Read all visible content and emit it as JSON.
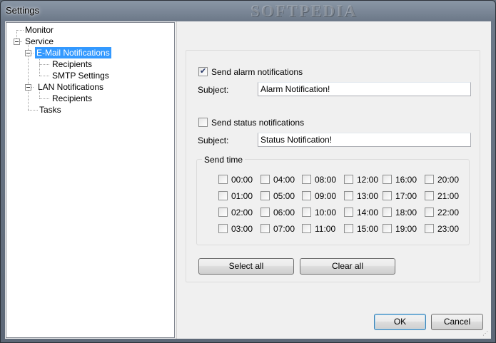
{
  "window": {
    "title": "Settings",
    "watermark": "SOFTPEDIA"
  },
  "tree": {
    "items": [
      {
        "label": "Monitor"
      },
      {
        "label": "Service"
      },
      {
        "label": "E-Mail Notifications"
      },
      {
        "label": "Recipients"
      },
      {
        "label": "SMTP  Settings"
      },
      {
        "label": "LAN Notifications"
      },
      {
        "label": "Recipients"
      },
      {
        "label": "Tasks"
      }
    ]
  },
  "email": {
    "alarm_label": "Send alarm notifications",
    "alarm_checked": true,
    "alarm_subject_label": "Subject:",
    "alarm_subject_value": "Alarm Notification!",
    "status_label": "Send status notifications",
    "status_checked": false,
    "status_subject_label": "Subject:",
    "status_subject_value": "Status Notification!",
    "send_time_label": "Send time",
    "hours": [
      "00:00",
      "04:00",
      "08:00",
      "12:00",
      "16:00",
      "20:00",
      "01:00",
      "05:00",
      "09:00",
      "13:00",
      "17:00",
      "21:00",
      "02:00",
      "06:00",
      "10:00",
      "14:00",
      "18:00",
      "22:00",
      "03:00",
      "07:00",
      "11:00",
      "15:00",
      "19:00",
      "23:00"
    ],
    "select_all_label": "Select all",
    "clear_all_label": "Clear all"
  },
  "footer": {
    "ok_label": "OK",
    "cancel_label": "Cancel"
  }
}
